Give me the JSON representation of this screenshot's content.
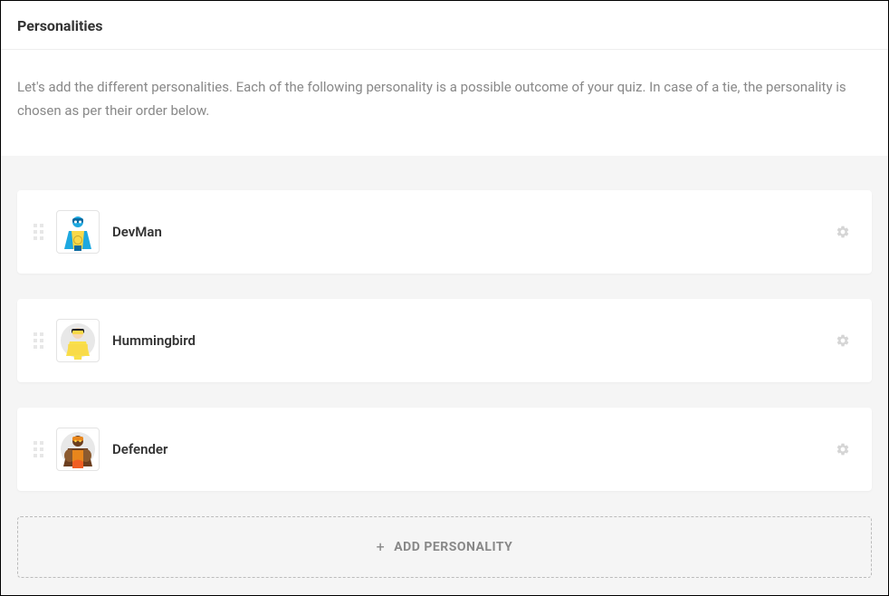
{
  "header": {
    "title": "Personalities"
  },
  "description": "Let's add the different personalities. Each of the following personality is a possible outcome of your quiz. In case of a tie, the personality is chosen as per their order below.",
  "personalities": [
    {
      "name": "DevMan",
      "avatar": "devman"
    },
    {
      "name": "Hummingbird",
      "avatar": "hummingbird"
    },
    {
      "name": "Defender",
      "avatar": "defender"
    }
  ],
  "add_button": {
    "label": "ADD PERSONALITY"
  }
}
